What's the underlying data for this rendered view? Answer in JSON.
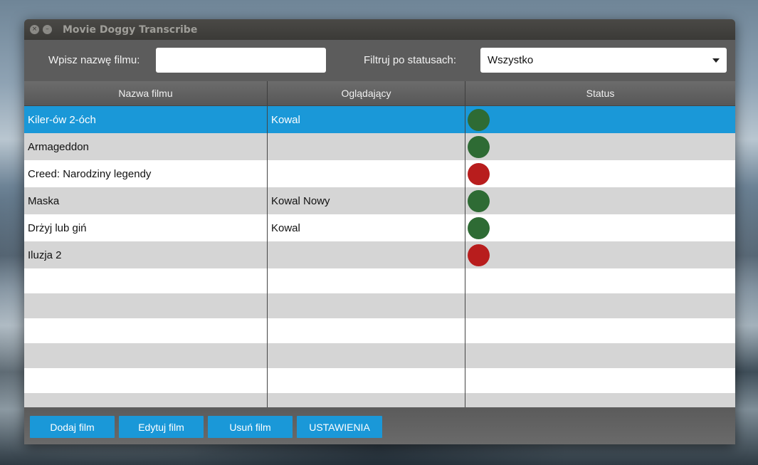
{
  "window": {
    "title": "Movie Doggy Transcribe"
  },
  "filters": {
    "search_label": "Wpisz nazwę filmu:",
    "search_value": "",
    "status_label": "Filtruj po statusach:",
    "status_selected": "Wszystko"
  },
  "table": {
    "columns": [
      "Nazwa filmu",
      "Oglądający",
      "Status"
    ],
    "rows": [
      {
        "name": "Kiler-ów 2-óch",
        "viewer": "Kowal",
        "status": "green",
        "selected": true
      },
      {
        "name": "Armageddon",
        "viewer": "",
        "status": "green",
        "selected": false
      },
      {
        "name": "Creed: Narodziny legendy",
        "viewer": "",
        "status": "red",
        "selected": false
      },
      {
        "name": "Maska",
        "viewer": "Kowal Nowy",
        "status": "green",
        "selected": false
      },
      {
        "name": "Drżyj lub giń",
        "viewer": "Kowal",
        "status": "green",
        "selected": false
      },
      {
        "name": "Iluzja 2",
        "viewer": "",
        "status": "red",
        "selected": false
      }
    ],
    "empty_rows": 6
  },
  "buttons": {
    "add": "Dodaj film",
    "edit": "Edytuj film",
    "delete": "Usuń film",
    "settings": "USTAWIENIA"
  },
  "colors": {
    "accent": "#1a98d8",
    "status_green": "#2e6b34",
    "status_red": "#b81d1d"
  }
}
